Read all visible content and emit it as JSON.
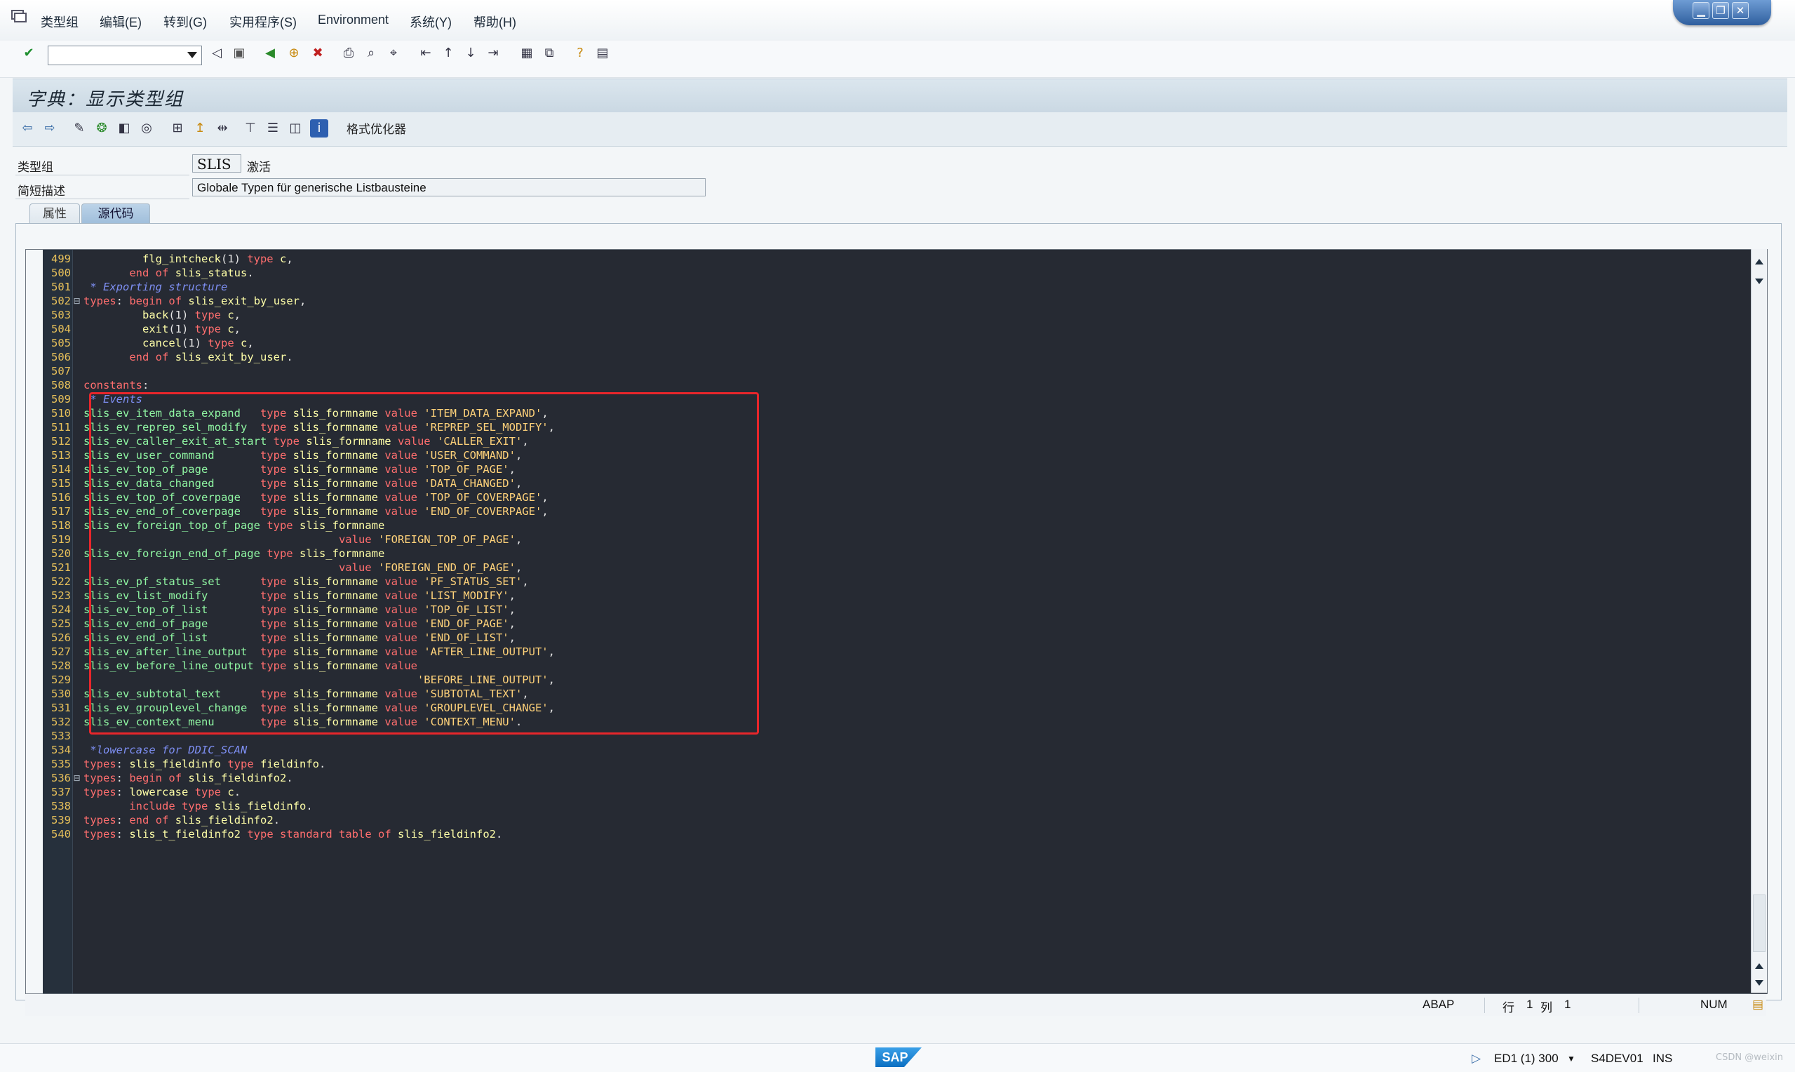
{
  "menu": {
    "items": [
      "类型组",
      "编辑(E)",
      "转到(G)",
      "实用程序(S)",
      "Environment",
      "系统(Y)",
      "帮助(H)"
    ]
  },
  "window_controls": [
    "minimize-icon",
    "restore-icon",
    "close-icon"
  ],
  "command_field": {
    "value": ""
  },
  "title": "字典：显示类型组",
  "app_toolbar": {
    "formatter_label": "格式优化器"
  },
  "fields": {
    "type_group_label": "类型组",
    "type_group_value": "SLIS",
    "status": "激活",
    "short_desc_label": "简短描述",
    "short_desc_value": "Globale Typen für generische Listbausteine"
  },
  "tabs": [
    {
      "label": "属性",
      "active": false
    },
    {
      "label": "源代码",
      "active": true
    }
  ],
  "code_lines": [
    {
      "n": "499",
      "t": "         flg_intcheck(1) type c,"
    },
    {
      "n": "500",
      "t": "       end of slis_status."
    },
    {
      "n": "501",
      "t": " * Exporting structure"
    },
    {
      "n": "502",
      "t": "types: begin of slis_exit_by_user,",
      "fold": "⊟"
    },
    {
      "n": "503",
      "t": "         back(1) type c,"
    },
    {
      "n": "504",
      "t": "         exit(1) type c,"
    },
    {
      "n": "505",
      "t": "         cancel(1) type c,"
    },
    {
      "n": "506",
      "t": "       end of slis_exit_by_user."
    },
    {
      "n": "507",
      "t": ""
    },
    {
      "n": "508",
      "t": "constants:"
    },
    {
      "n": "509",
      "t": " * Events"
    },
    {
      "n": "510",
      "t": "slis_ev_item_data_expand   type slis_formname value 'ITEM_DATA_EXPAND',"
    },
    {
      "n": "511",
      "t": "slis_ev_reprep_sel_modify  type slis_formname value 'REPREP_SEL_MODIFY',"
    },
    {
      "n": "512",
      "t": "slis_ev_caller_exit_at_start type slis_formname value 'CALLER_EXIT',"
    },
    {
      "n": "513",
      "t": "slis_ev_user_command       type slis_formname value 'USER_COMMAND',"
    },
    {
      "n": "514",
      "t": "slis_ev_top_of_page        type slis_formname value 'TOP_OF_PAGE',"
    },
    {
      "n": "515",
      "t": "slis_ev_data_changed       type slis_formname value 'DATA_CHANGED',"
    },
    {
      "n": "516",
      "t": "slis_ev_top_of_coverpage   type slis_formname value 'TOP_OF_COVERPAGE',"
    },
    {
      "n": "517",
      "t": "slis_ev_end_of_coverpage   type slis_formname value 'END_OF_COVERPAGE',"
    },
    {
      "n": "518",
      "t": "slis_ev_foreign_top_of_page type slis_formname"
    },
    {
      "n": "519",
      "t": "                                       value 'FOREIGN_TOP_OF_PAGE',"
    },
    {
      "n": "520",
      "t": "slis_ev_foreign_end_of_page type slis_formname"
    },
    {
      "n": "521",
      "t": "                                       value 'FOREIGN_END_OF_PAGE',"
    },
    {
      "n": "522",
      "t": "slis_ev_pf_status_set      type slis_formname value 'PF_STATUS_SET',"
    },
    {
      "n": "523",
      "t": "slis_ev_list_modify        type slis_formname value 'LIST_MODIFY',"
    },
    {
      "n": "524",
      "t": "slis_ev_top_of_list        type slis_formname value 'TOP_OF_LIST',"
    },
    {
      "n": "525",
      "t": "slis_ev_end_of_page        type slis_formname value 'END_OF_PAGE',"
    },
    {
      "n": "526",
      "t": "slis_ev_end_of_list        type slis_formname value 'END_OF_LIST',"
    },
    {
      "n": "527",
      "t": "slis_ev_after_line_output  type slis_formname value 'AFTER_LINE_OUTPUT',"
    },
    {
      "n": "528",
      "t": "slis_ev_before_line_output type slis_formname value"
    },
    {
      "n": "529",
      "t": "                                                   'BEFORE_LINE_OUTPUT',"
    },
    {
      "n": "530",
      "t": "slis_ev_subtotal_text      type slis_formname value 'SUBTOTAL_TEXT',"
    },
    {
      "n": "531",
      "t": "slis_ev_grouplevel_change  type slis_formname value 'GROUPLEVEL_CHANGE',"
    },
    {
      "n": "532",
      "t": "slis_ev_context_menu       type slis_formname value 'CONTEXT_MENU'."
    },
    {
      "n": "533",
      "t": ""
    },
    {
      "n": "534",
      "t": " *lowercase for DDIC_SCAN"
    },
    {
      "n": "535",
      "t": "types: slis_fieldinfo type fieldinfo."
    },
    {
      "n": "536",
      "t": "types: begin of slis_fieldinfo2.",
      "fold": "⊟"
    },
    {
      "n": "537",
      "t": "types: lowercase type c."
    },
    {
      "n": "538",
      "t": "       include type slis_fieldinfo."
    },
    {
      "n": "539",
      "t": "types: end of slis_fieldinfo2."
    },
    {
      "n": "540",
      "t": "types: slis_t_fieldinfo2 type standard table of slis_fieldinfo2."
    }
  ],
  "editor_status": {
    "language": "ABAP",
    "row_label": "行",
    "row": "1",
    "col_label": "列",
    "col": "1",
    "num": "NUM"
  },
  "status_bar": {
    "system": "ED1 (1) 300",
    "server": "S4DEV01",
    "mode": "INS",
    "logo": "SAP",
    "watermark": "CSDN @weixin"
  },
  "colors": {
    "editor_bg": "#262a33",
    "keyword": "#ff6e6e",
    "identifier": "#ffffa8",
    "comment": "#7e8ff3",
    "highlight_box": "#e8262b"
  }
}
